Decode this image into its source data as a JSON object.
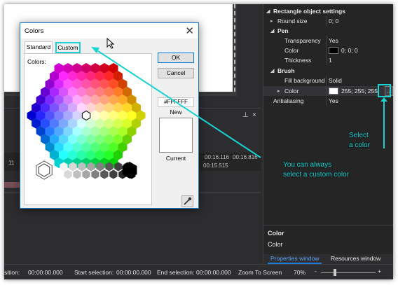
{
  "colors": {
    "accent": "#19d2d2",
    "dialog_border": "#1979ca",
    "dark_bg": "#2d2d30",
    "panel_bg": "#252526",
    "active_tab": "#5aa6ff"
  },
  "properties": {
    "header": "Rectangle object settings",
    "rows": {
      "round_size": {
        "label": "Round size",
        "value": "0; 0"
      },
      "pen": {
        "label": "Pen"
      },
      "transparency": {
        "label": "Transparency",
        "value": "Yes"
      },
      "pen_color": {
        "label": "Color",
        "value": "0; 0; 0"
      },
      "thickness": {
        "label": "Thickness",
        "value": "1"
      },
      "brush": {
        "label": "Brush"
      },
      "fill_background": {
        "label": "Fill background",
        "value": "Solid"
      },
      "brush_color": {
        "label": "Color",
        "value": "255; 255; 255"
      },
      "antialiasing": {
        "label": "Antialiasing",
        "value": "Yes"
      }
    },
    "ellipsis": "...",
    "description": {
      "title": "Color",
      "text": "Color"
    },
    "tabs": [
      "Properties window",
      "Resources window"
    ]
  },
  "timeline": {
    "ruler": [
      "11",
      "00:16.116",
      "00:16.816",
      "00:15.515"
    ]
  },
  "status_bar": {
    "position": "sition:",
    "position_value": "00:00:00.000",
    "start_selection": "Start selection:",
    "start_value": "00:00:00.000",
    "end_selection": "End selection:",
    "end_value": "00:00:00.000",
    "zoom_to_screen": "Zoom To Screen",
    "zoom": "70%",
    "minus": "-",
    "plus": "+"
  },
  "dialog": {
    "title": "Colors",
    "close": "✕",
    "tabs": {
      "standard": "Standard",
      "custom": "Custom"
    },
    "colors_label": "Colors:",
    "ok": "OK",
    "cancel": "Cancel",
    "hex_value": "#FFFFFF",
    "new_label": "New",
    "current_label": "Current"
  },
  "annotations": {
    "custom_line1": "You can always",
    "custom_line2": "select a custom color",
    "select_line1": "Select",
    "select_line2": "a color"
  },
  "icons": {
    "close": "close-icon",
    "eyedropper": "eyedropper-icon",
    "pin": "pin-icon",
    "cursor": "mouse-cursor-icon"
  }
}
